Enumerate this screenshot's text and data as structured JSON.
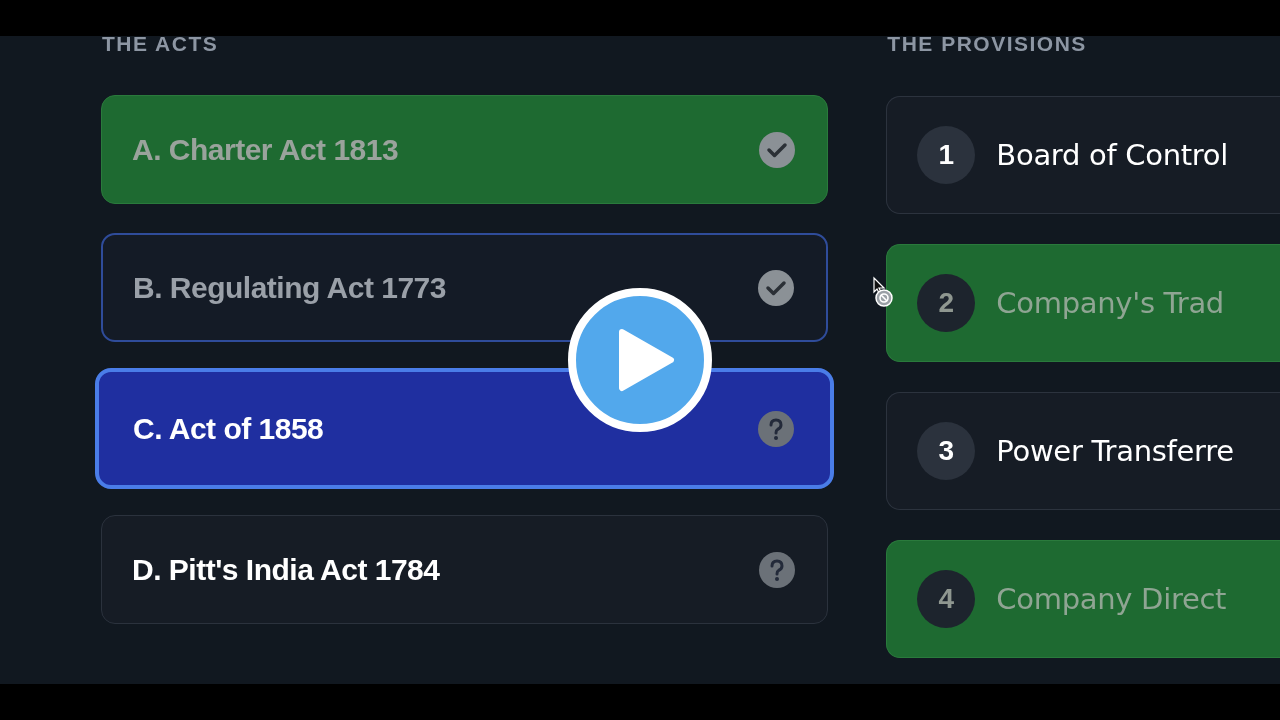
{
  "acts_heading": "THE ACTS",
  "acts": [
    {
      "label": "A. Charter Act 1813",
      "kind": "correct",
      "selected": false
    },
    {
      "label": "B. Regulating Act 1773",
      "kind": "paired",
      "selected": false
    },
    {
      "label": "C. Act of 1858",
      "kind": "pending",
      "selected": true
    },
    {
      "label": "D. Pitt's India Act 1784",
      "kind": "pending",
      "selected": false
    }
  ],
  "provisions_heading": "THE PROVISIONS",
  "provisions": [
    {
      "number": "1",
      "text": "Board of Control",
      "matched": false
    },
    {
      "number": "2",
      "text": "Company's Trad",
      "matched": true
    },
    {
      "number": "3",
      "text": "Power Transferre",
      "matched": false
    },
    {
      "number": "4",
      "text": "Company Direct",
      "matched": true
    }
  ]
}
